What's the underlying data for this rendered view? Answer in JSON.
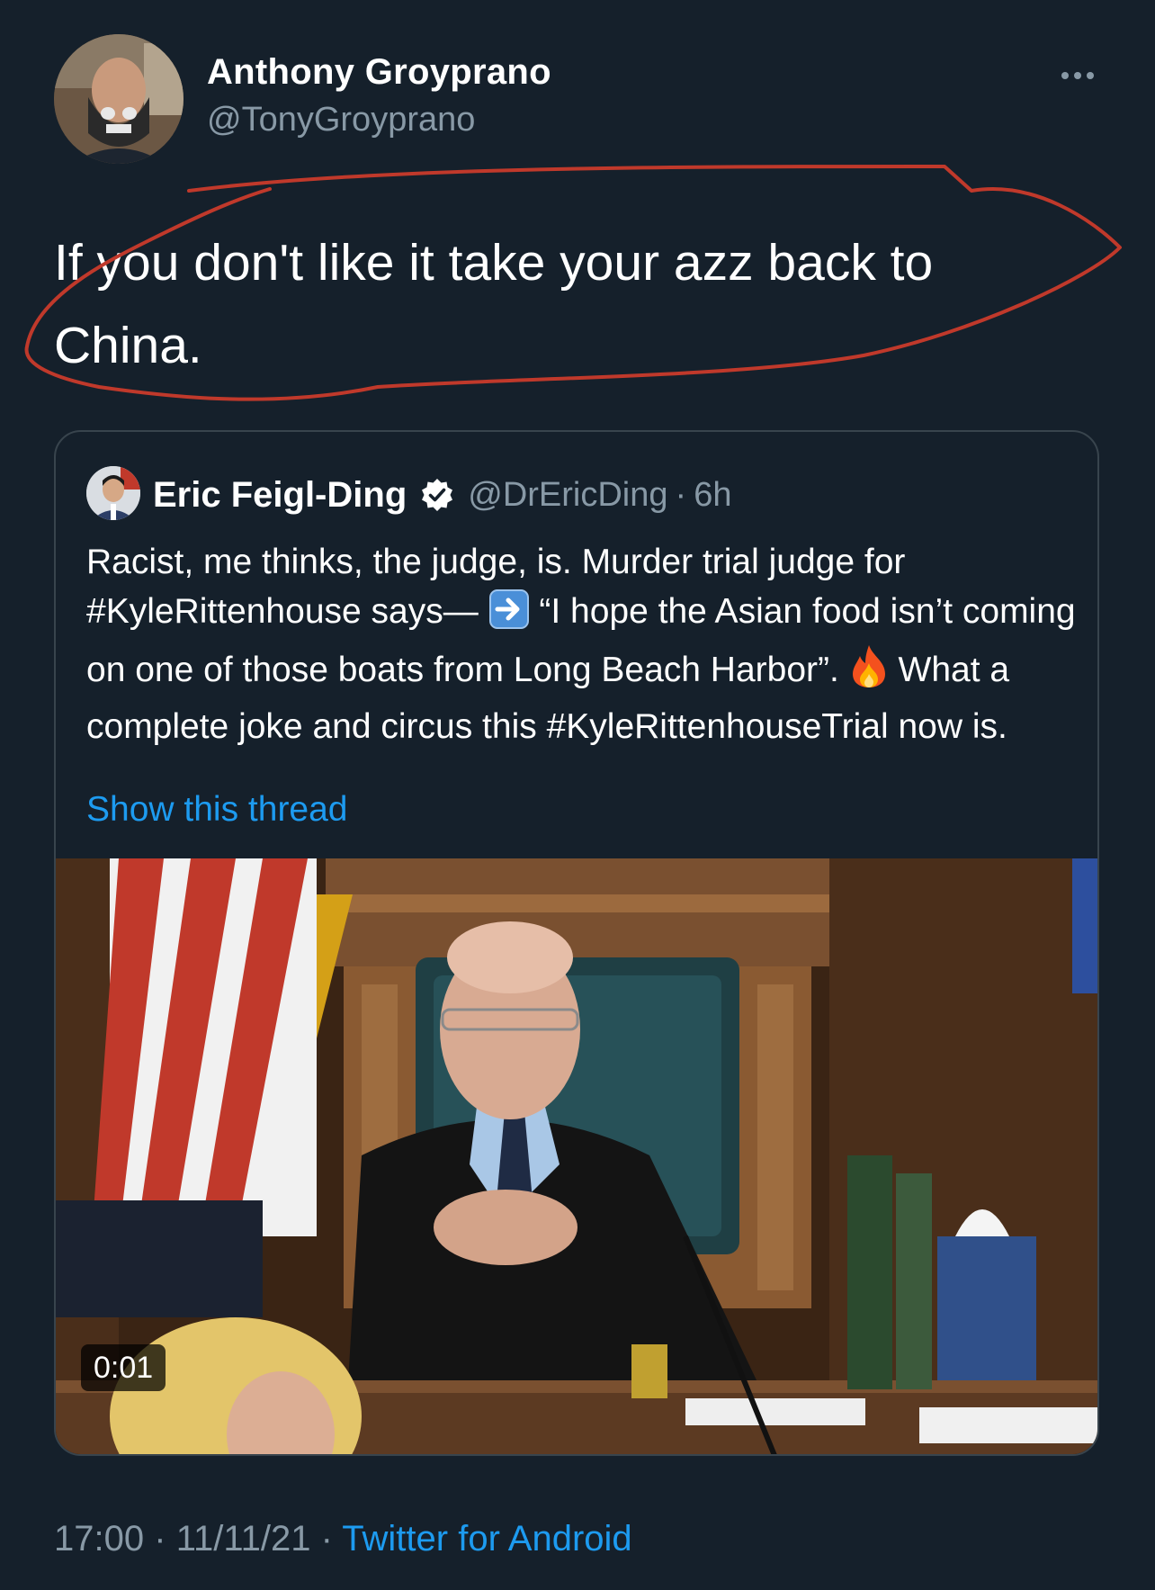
{
  "tweet": {
    "author_name": "Anthony Groyprano",
    "author_handle": "@TonyGroyprano",
    "text_line1": "If you don't like it take your azz back to",
    "text_line2": "China.",
    "time": "17:00",
    "separator": "·",
    "date": "11/11/21",
    "source": "Twitter for Android",
    "more_icon": "more-horizontal-icon"
  },
  "quoted": {
    "author_name": "Eric Feigl-Ding",
    "author_handle": "@DrEricDing",
    "dot": "·",
    "age": "6h",
    "verified_icon": "verified-badge-icon",
    "text_part1": "Racist, me thinks, the judge, is. Murder trial judge for #KyleRittenhouse says— ",
    "text_part2": " “I hope the Asian food isn’t coming on one of those boats from Long Beach Harbor”. ",
    "text_part3": " What a complete joke and circus this #KyleRittenhouseTrial now is.",
    "arrow_icon": "right-arrow-emoji",
    "fire_icon": "fire-emoji",
    "show_thread": "Show this thread",
    "video_timer": "0:01"
  },
  "colors": {
    "background": "#15202b",
    "text": "#ffffff",
    "secondary_text": "#8899a6",
    "link": "#1d9bf0",
    "border": "#38444d",
    "annotation": "#c0392b"
  }
}
